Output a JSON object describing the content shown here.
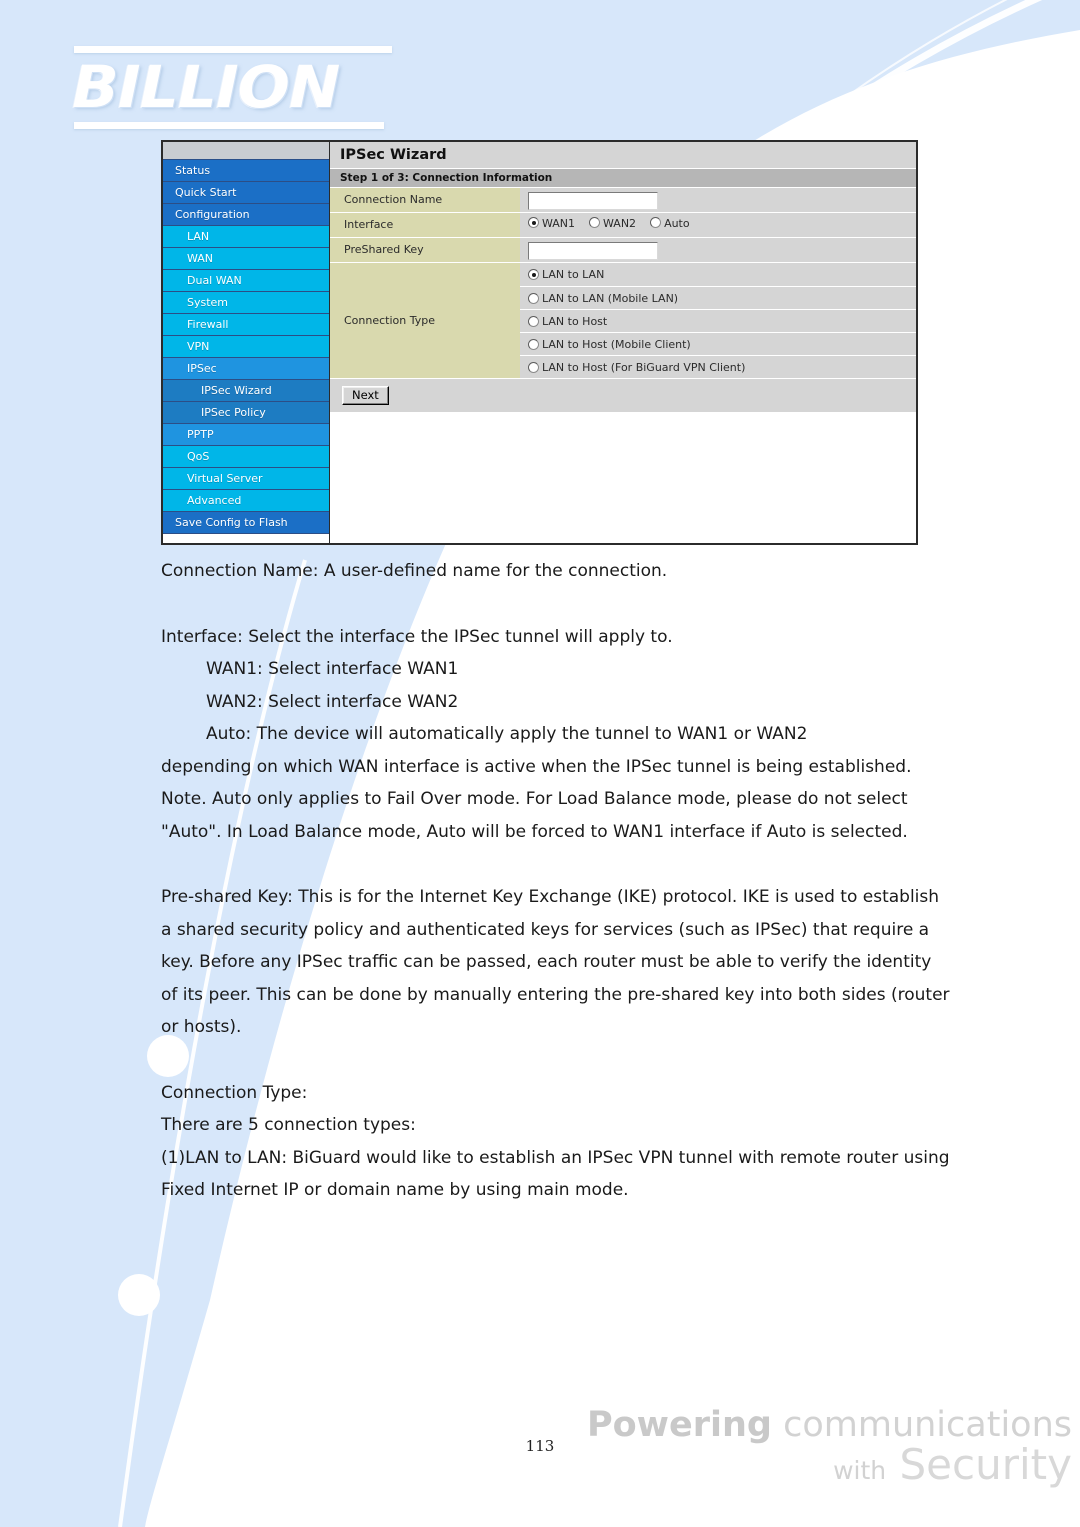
{
  "logo": {
    "brand": "BILLION"
  },
  "sidebar": {
    "items": [
      {
        "label": "Status",
        "level": 0
      },
      {
        "label": "Quick Start",
        "level": 0
      },
      {
        "label": "Configuration",
        "level": 0
      },
      {
        "label": "LAN",
        "level": 1
      },
      {
        "label": "WAN",
        "level": 1
      },
      {
        "label": "Dual WAN",
        "level": 1
      },
      {
        "label": "System",
        "level": 1
      },
      {
        "label": "Firewall",
        "level": 1
      },
      {
        "label": "VPN",
        "level": 1
      },
      {
        "label": "IPSec",
        "level": "1b"
      },
      {
        "label": "IPSec Wizard",
        "level": 2
      },
      {
        "label": "IPSec Policy",
        "level": 2
      },
      {
        "label": "PPTP",
        "level": "1b"
      },
      {
        "label": "QoS",
        "level": 1
      },
      {
        "label": "Virtual Server",
        "level": 1
      },
      {
        "label": "Advanced",
        "level": 1
      },
      {
        "label": "Save Config to Flash",
        "level": "save"
      }
    ]
  },
  "panel": {
    "title": "IPSec Wizard",
    "step": "Step 1 of 3: Connection Information",
    "fields": {
      "connection_name_label": "Connection Name",
      "connection_name_value": "",
      "interface_label": "Interface",
      "preshared_key_label": "PreShared Key",
      "preshared_key_value": "",
      "connection_type_label": "Connection Type"
    },
    "interface_options": [
      {
        "label": "WAN1",
        "selected": true
      },
      {
        "label": "WAN2",
        "selected": false
      },
      {
        "label": "Auto",
        "selected": false
      }
    ],
    "connection_type_options": [
      {
        "label": "LAN to LAN",
        "selected": true
      },
      {
        "label": "LAN to LAN (Mobile LAN)",
        "selected": false
      },
      {
        "label": "LAN to Host",
        "selected": false
      },
      {
        "label": "LAN to Host (Mobile Client)",
        "selected": false
      },
      {
        "label": "LAN to Host (For BiGuard VPN Client)",
        "selected": false
      }
    ],
    "next_label": "Next"
  },
  "body": {
    "p1": "Connection Name: A user-defined name for the connection.",
    "p2": "Interface: Select the interface the IPSec tunnel will apply to.",
    "p2a": "WAN1: Select interface WAN1",
    "p2b": "WAN2: Select interface WAN2",
    "p2c": "Auto: The device will automatically apply the tunnel to WAN1 or WAN2",
    "p2d": "depending on which WAN interface is active when the IPSec tunnel is being established. Note. Auto only applies to Fail Over mode. For Load Balance mode, please do not select \"Auto\". In Load Balance mode, Auto will be forced to WAN1 interface if Auto is selected.",
    "p3": "Pre-shared Key: This is for the Internet Key Exchange (IKE) protocol. IKE is used to establish a shared security policy and authenticated keys for services (such as IPSec) that require a key. Before any IPSec traffic can be passed, each router must be able to verify the identity of its peer. This can be done by manually entering the pre-shared key into both sides (router or hosts).",
    "p4": "Connection Type:",
    "p5": "There are 5 connection types:",
    "p6": "(1)LAN to LAN: BiGuard would like to establish an IPSec VPN tunnel with remote router using Fixed Internet IP or domain name by using main mode."
  },
  "footer": {
    "page_number": "113",
    "slogan_line1_bold": "Powering",
    "slogan_line1_rest": "communications",
    "slogan_line2_small": "with",
    "slogan_line2_big": "Security"
  },
  "colors": {
    "sidebar_level0": "#1b6fc6",
    "sidebar_level1": "#00b6e8",
    "sidebar_level1b": "#1f94e0",
    "sidebar_level2": "#1d7cc2",
    "panel_title_bg": "#d5d5d5",
    "panel_step_bg": "#b6b6b6",
    "label_cell_bg": "#d9d9ae",
    "field_cell_bg": "#d5d5d5",
    "page_accent": "#d7e7fa"
  }
}
